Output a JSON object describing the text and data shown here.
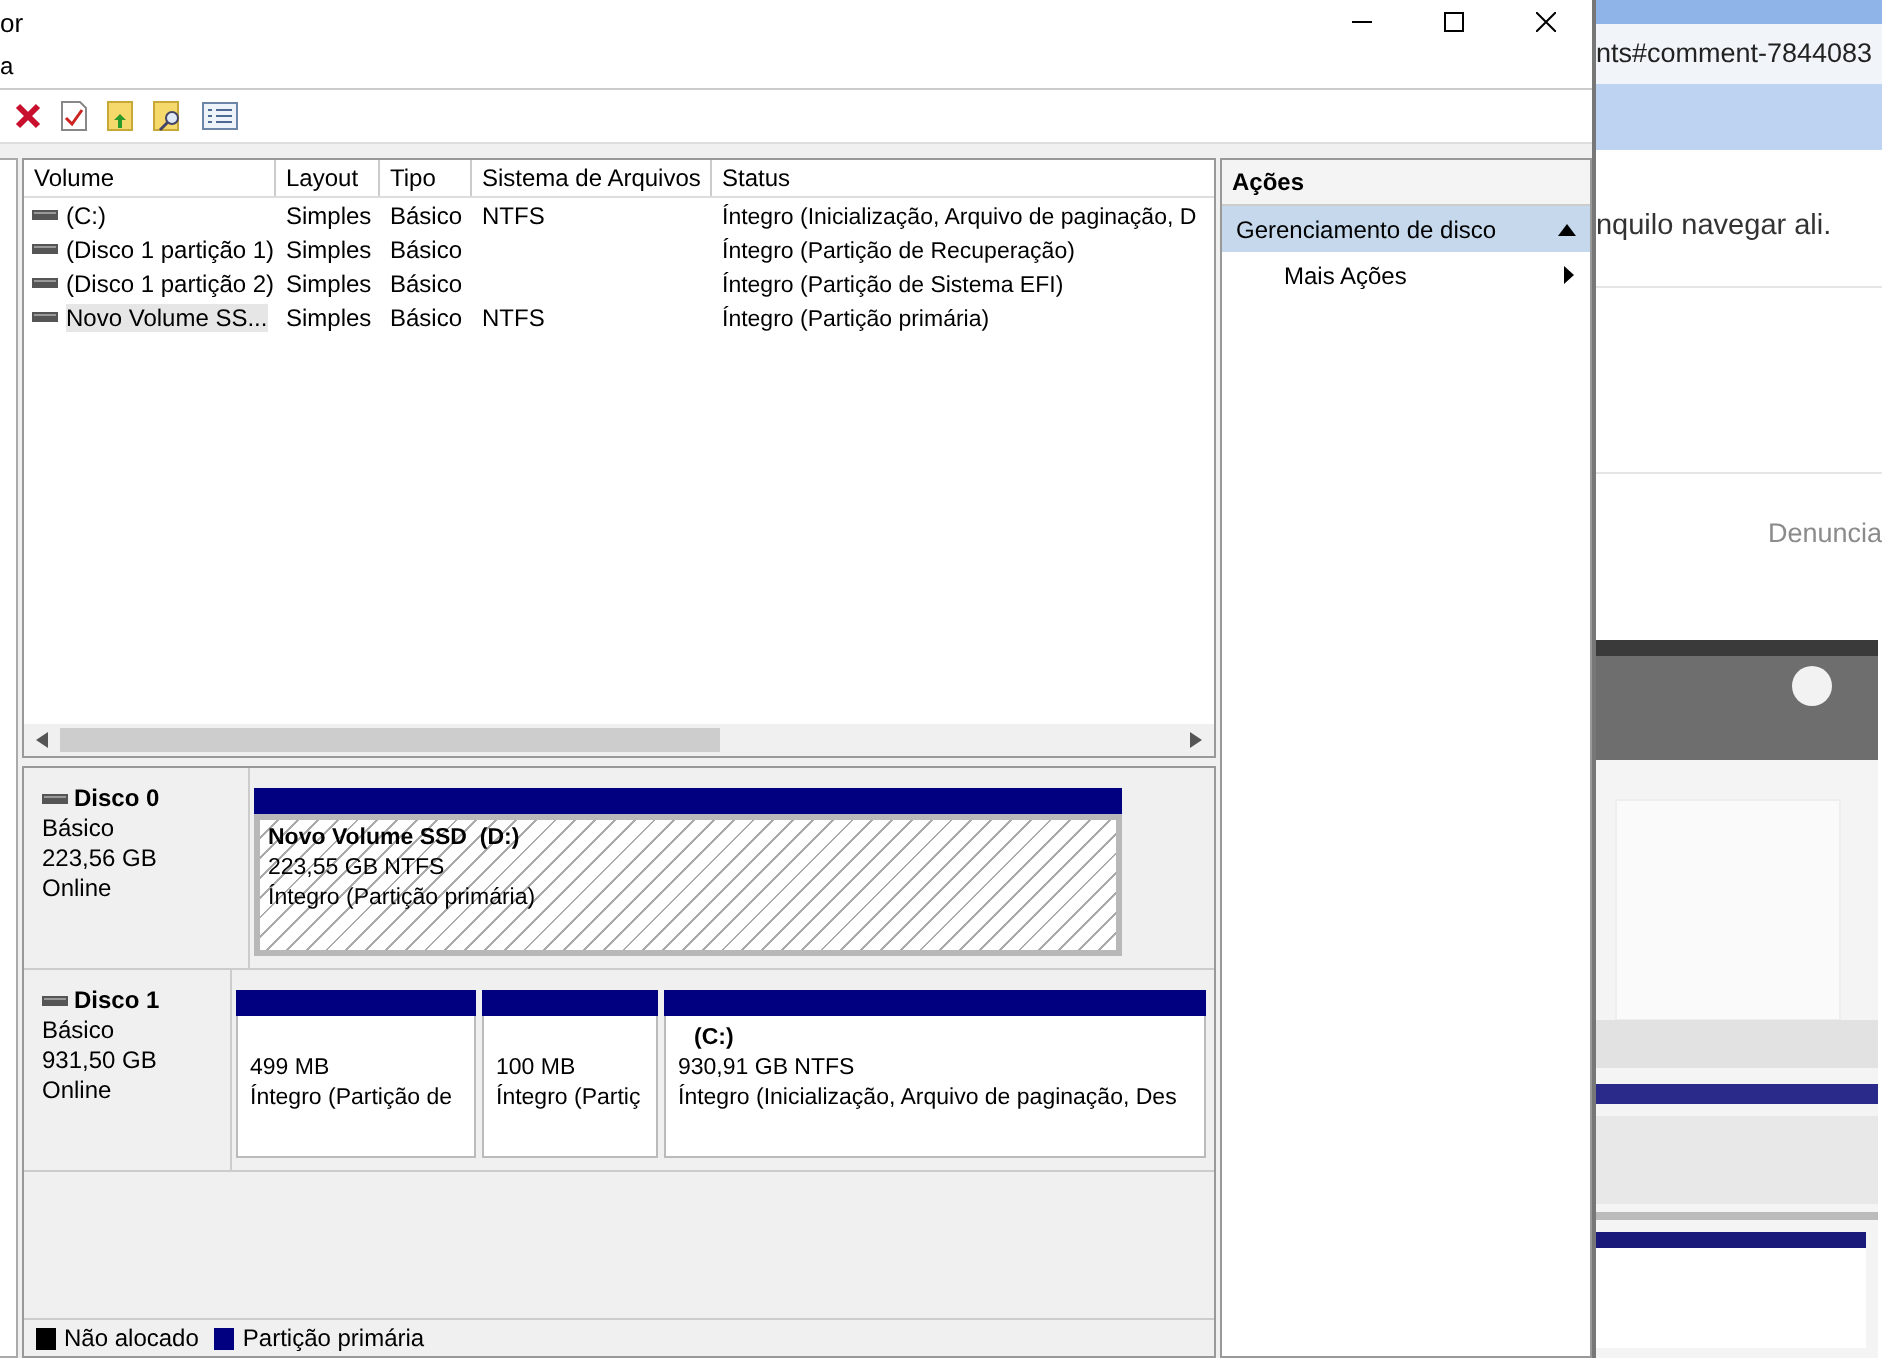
{
  "window": {
    "title": "or",
    "menu": [
      "a"
    ]
  },
  "volume_table": {
    "columns": [
      "Volume",
      "Layout",
      "Tipo",
      "Sistema de Arquivos",
      "Status"
    ],
    "rows": [
      {
        "cells": [
          "(C:)",
          "Simples",
          "Básico",
          "NTFS",
          "Íntegro (Inicialização, Arquivo de paginação, D"
        ],
        "selected": false
      },
      {
        "cells": [
          "(Disco 1 partição 1)",
          "Simples",
          "Básico",
          "",
          "Íntegro (Partição de Recuperação)"
        ],
        "selected": false
      },
      {
        "cells": [
          "(Disco 1 partição 2)",
          "Simples",
          "Básico",
          "",
          "Íntegro (Partição de Sistema EFI)"
        ],
        "selected": false
      },
      {
        "cells": [
          "Novo Volume SS...",
          "Simples",
          "Básico",
          "NTFS",
          "Íntegro (Partição primária)"
        ],
        "selected": true
      }
    ]
  },
  "disks": [
    {
      "name": "Disco 0",
      "type": "Básico",
      "size": "223,56 GB",
      "status": "Online",
      "partitions": [
        {
          "title": "Novo Volume SSD  (D:)",
          "size": "223,55 GB NTFS",
          "status": "Íntegro (Partição primária)",
          "selected": true
        }
      ]
    },
    {
      "name": "Disco 1",
      "type": "Básico",
      "size": "931,50 GB",
      "status": "Online",
      "partitions": [
        {
          "size": "499 MB",
          "status": "Íntegro (Partição de",
          "selected": false
        },
        {
          "size": "100 MB",
          "status": "Íntegro (Partiç",
          "selected": false
        },
        {
          "title": "(C:)",
          "size": "930,91 GB NTFS",
          "status": "Íntegro (Inicialização, Arquivo de paginação, Des",
          "selected": false
        }
      ]
    }
  ],
  "legend": [
    {
      "label": "Não alocado",
      "color": "#000000"
    },
    {
      "label": "Partição primária",
      "color": "#000080"
    }
  ],
  "actions": {
    "title": "Ações",
    "sections": [
      {
        "label": "Gerenciamento de disco",
        "expanded": true,
        "items": [
          {
            "label": "Mais Ações"
          }
        ]
      }
    ]
  },
  "browser": {
    "url": "nts#comment-7844083",
    "comment_text": "nquilo navegar ali.",
    "report_link": "Denuncia"
  }
}
